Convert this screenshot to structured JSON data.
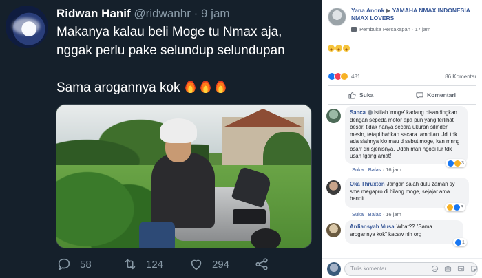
{
  "tweet": {
    "name": "Ridwan Hanif",
    "handle": "@ridwanhr",
    "separator": "·",
    "time": "9 jam",
    "line1": "Makanya kalau beli Moge tu Nmax aja,",
    "line2": "nggak perlu pake selundup selundupan",
    "line3": "Sama arogannya kok",
    "emoji": "fire-icon x3",
    "actions": {
      "replies": "58",
      "retweets": "124",
      "likes": "294"
    }
  },
  "facebook": {
    "author": "Yana Anonk",
    "arrow": "▶",
    "group": "YAMAHA NMAX INDONESIA NMAX LOVERS",
    "post_type": "Pembuka Percakapan",
    "post_time": "17 jam",
    "body": "grinning-face-emoji x3",
    "reaction_count": "481",
    "comment_count": "86 Komentar",
    "like_label": "Suka",
    "comment_label": "Komentari",
    "comments": [
      {
        "name": "Sanca",
        "text": "Istilah 'moge' kadang disandingkan dengan sepeda motor apa pun yang terlihat besar, tidak hanya secara ukuran silinder mesin, tetapi bahkan secara tampilan. Jdi tdk ada slahnya klo mau d sebut moge, kan mnng bsarr dri sjenisnya. Udah mari ngopi lur tdk usah tgang amat!",
        "like": "Suka",
        "reply": "Balas",
        "dot": "·",
        "time": "16 jam",
        "reactions": "3"
      },
      {
        "name": "Oka Thruxton",
        "text": "Jangan salah dulu zaman sy sma megapro di bilang moge, sejajar ama bandit",
        "like": "Suka",
        "reply": "Balas",
        "dot": "·",
        "time": "16 jam",
        "reactions": "3"
      },
      {
        "name": "Ardiansyah Musa",
        "text": "What?? \"Sama arogannya kok\" kacaw nih org",
        "reactions": "1"
      }
    ],
    "input_placeholder": "Tulis komentar..."
  }
}
